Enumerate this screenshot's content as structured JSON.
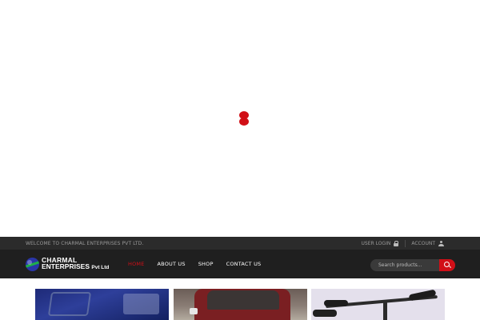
{
  "topbar": {
    "welcome": "WELCOME TO CHARMAL ENTERPRISES PVT LTD.",
    "user_login": "USER LOGIN",
    "user_login_icon": "lock-icon",
    "account": "ACCOUNT",
    "account_icon": "user-icon"
  },
  "logo": {
    "line1": "CHARMAL",
    "line2": "ENTERPRISES",
    "suffix": "Pvt Ltd"
  },
  "nav": {
    "items": [
      {
        "label": "HOME",
        "active": true
      },
      {
        "label": "ABOUT US",
        "active": false
      },
      {
        "label": "SHOP",
        "active": false
      },
      {
        "label": "CONTACT US",
        "active": false
      }
    ]
  },
  "search": {
    "placeholder": "Search products...",
    "button_icon": "search-icon"
  },
  "colors": {
    "accent": "#d10f17",
    "topbar_bg": "#2b2b2b",
    "header_bg": "#1f1f1f"
  }
}
